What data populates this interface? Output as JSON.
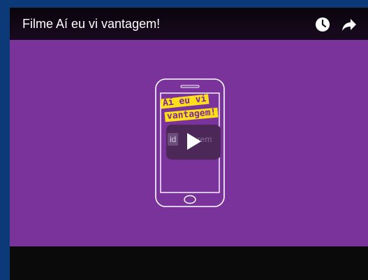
{
  "video": {
    "title": "Filme Aí eu vi vantagem!",
    "background_color": "#7a339a"
  },
  "controls": {
    "watch_later_icon": "clock-icon",
    "share_icon": "share-arrow-icon"
  },
  "sticker": {
    "line1": "Aí eu vi",
    "line2": "vantagem!"
  },
  "thumbnail": {
    "logo_prefix": "id",
    "logo_suffix": "rem",
    "play_icon": "play-icon"
  }
}
